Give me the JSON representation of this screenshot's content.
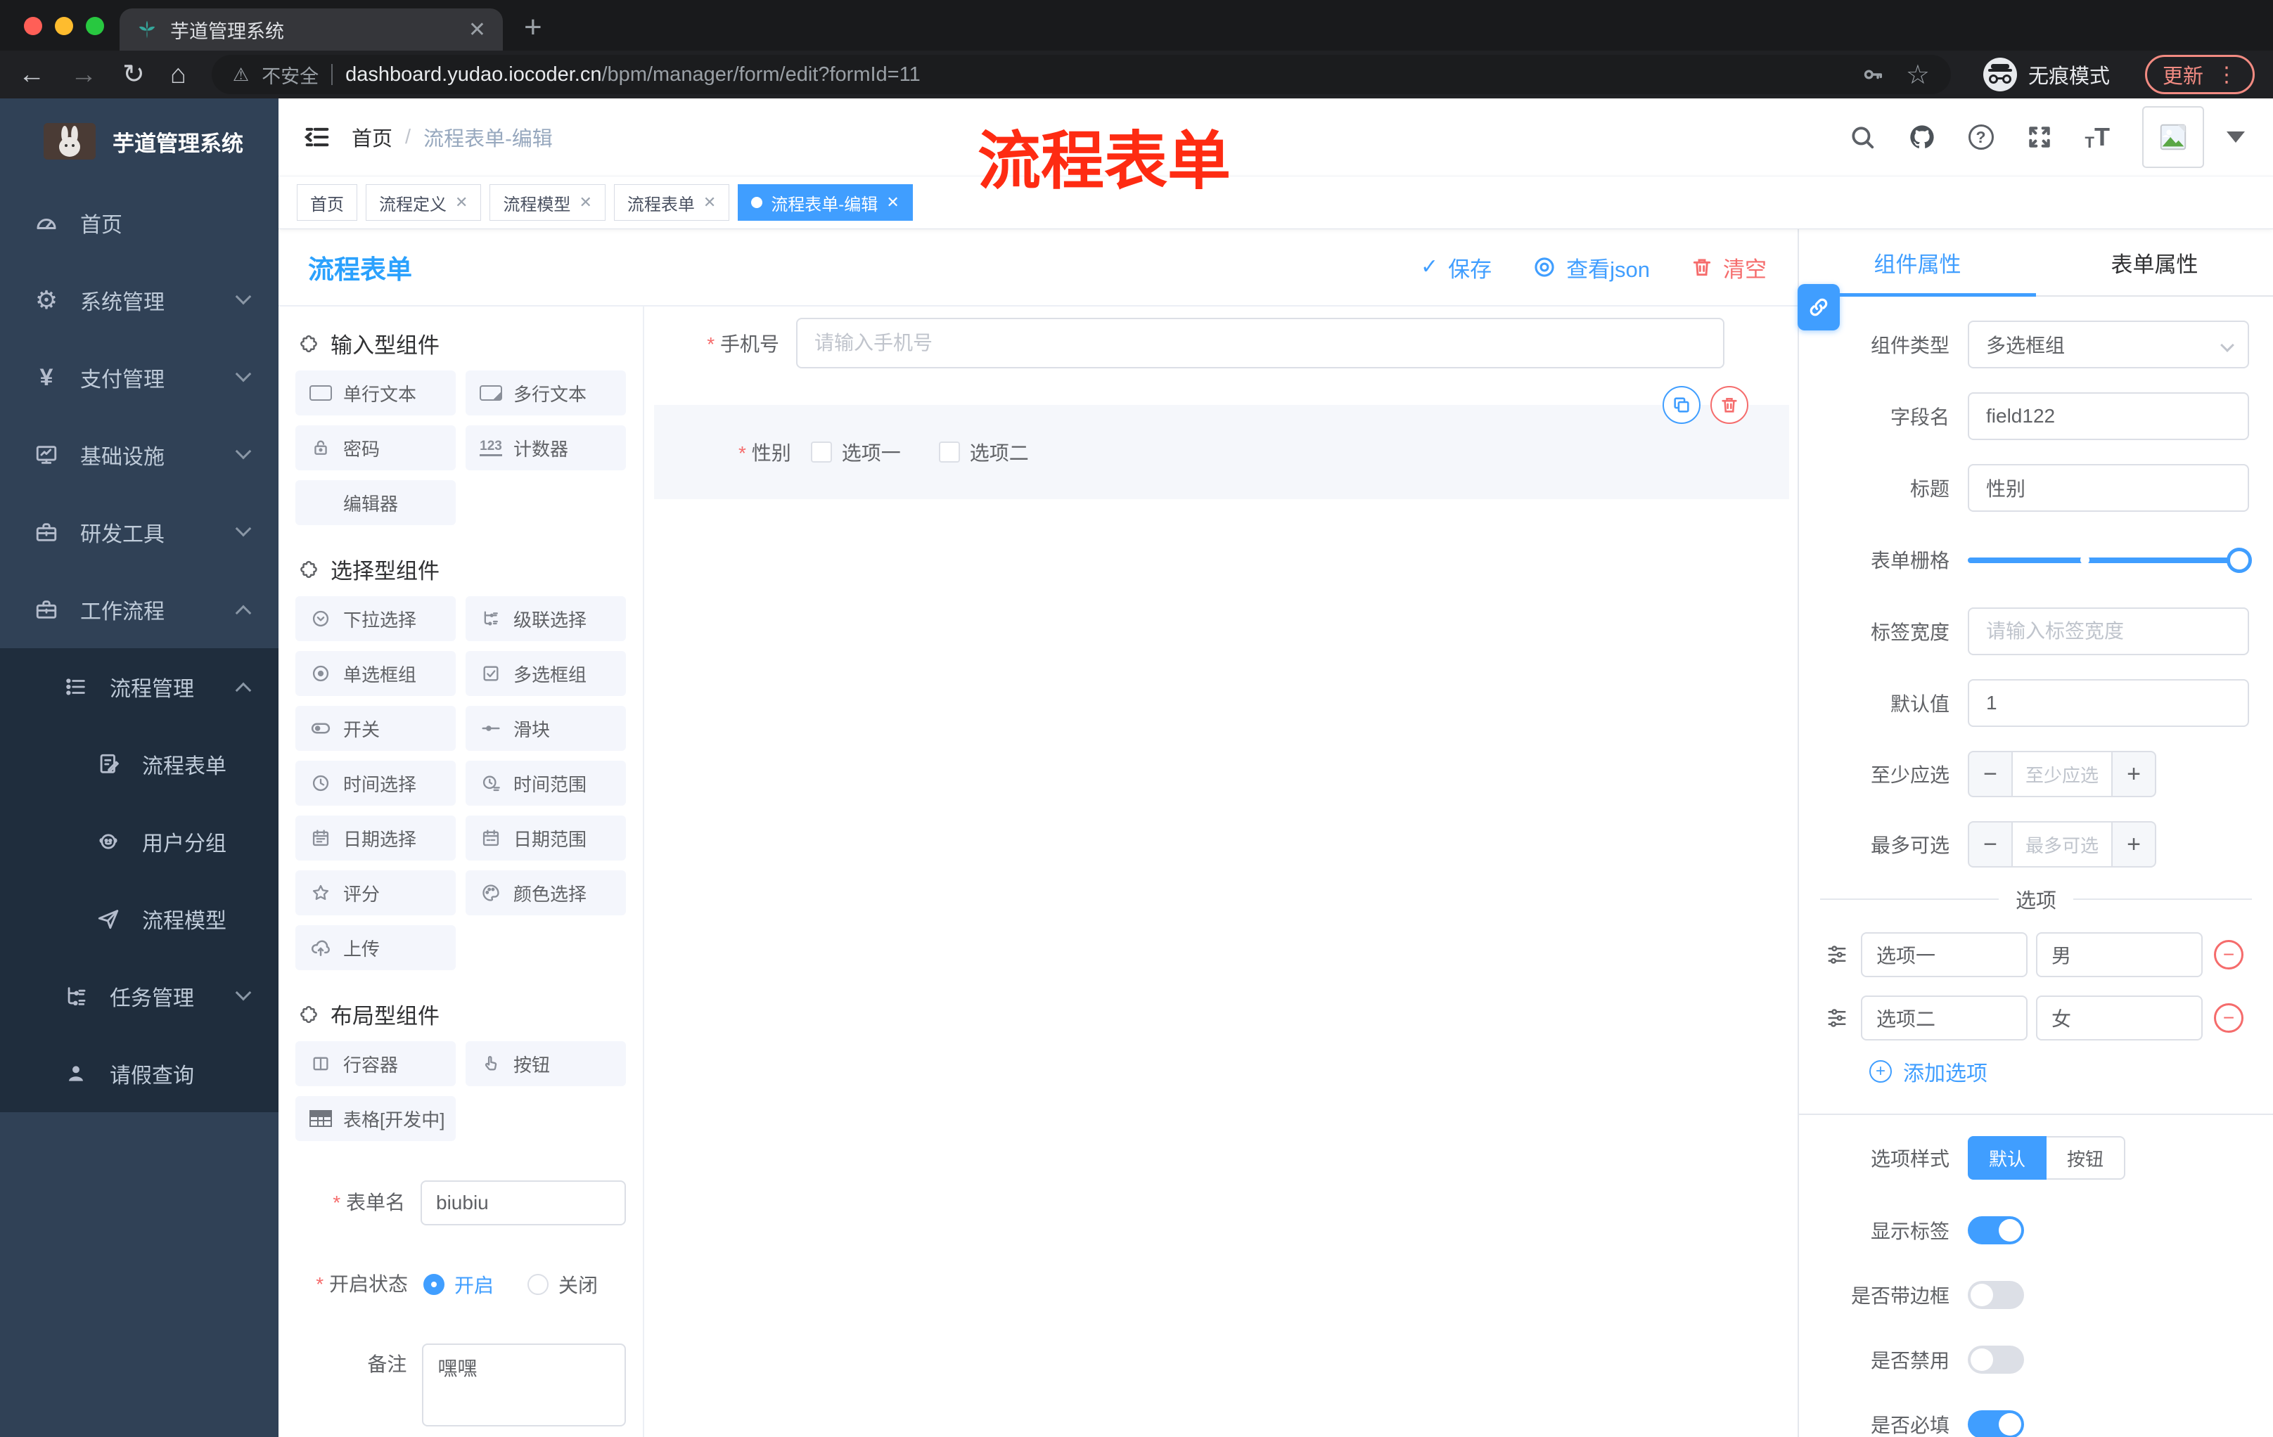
{
  "appearance": {
    "accent": "#409eff",
    "danger": "#f56c6c",
    "sidebar_bg": "#304156",
    "sidebar_submenu_bg": "#1f2d3d",
    "chrome_bg": "#202124",
    "active_tag_bg": "#409eff",
    "annotation_color": "#fe2b12"
  },
  "browser": {
    "tab_title": "芋道管理系统",
    "security_label": "不安全",
    "url_domain": "dashboard.yudao.iocoder.cn",
    "url_path": "/bpm/manager/form/edit?formId=11",
    "incognito_label": "无痕模式",
    "update_label": "更新"
  },
  "sidebar": {
    "brand": "芋道管理系统",
    "menu": [
      {
        "label": "首页",
        "icon": "dashboard"
      },
      {
        "label": "系统管理",
        "icon": "gear",
        "chevron": "down"
      },
      {
        "label": "支付管理",
        "icon": "yen",
        "chevron": "down"
      },
      {
        "label": "基础设施",
        "icon": "monitor",
        "chevron": "down"
      },
      {
        "label": "研发工具",
        "icon": "briefcase",
        "chevron": "down"
      },
      {
        "label": "工作流程",
        "icon": "briefcase",
        "chevron": "up",
        "children": [
          {
            "label": "流程管理",
            "icon": "list",
            "chevron": "up",
            "children": [
              {
                "label": "流程表单",
                "icon": "doc-edit"
              },
              {
                "label": "用户分组",
                "icon": "face"
              },
              {
                "label": "流程模型",
                "icon": "plane"
              }
            ]
          },
          {
            "label": "任务管理",
            "icon": "tree",
            "chevron": "down"
          },
          {
            "label": "请假查询",
            "icon": "person"
          }
        ]
      }
    ]
  },
  "header": {
    "breadcrumb": [
      "首页",
      "流程表单-编辑"
    ],
    "annotation": "流程表单"
  },
  "tags": [
    {
      "label": "首页",
      "closable": false,
      "active": false
    },
    {
      "label": "流程定义",
      "closable": true,
      "active": false
    },
    {
      "label": "流程模型",
      "closable": true,
      "active": false
    },
    {
      "label": "流程表单",
      "closable": true,
      "active": false
    },
    {
      "label": "流程表单-编辑",
      "closable": true,
      "active": true
    }
  ],
  "editor": {
    "title": "流程表单",
    "save": "保存",
    "view_json": "查看json",
    "clear": "清空"
  },
  "components": {
    "sections": [
      {
        "title": "输入型组件",
        "items": [
          {
            "label": "单行文本",
            "icon": "input"
          },
          {
            "label": "多行文本",
            "icon": "textarea"
          },
          {
            "label": "密码",
            "icon": "lock"
          },
          {
            "label": "计数器",
            "icon": "counter"
          },
          {
            "label": "编辑器",
            "icon": "blank"
          }
        ]
      },
      {
        "title": "选择型组件",
        "items": [
          {
            "label": "下拉选择",
            "icon": "select"
          },
          {
            "label": "级联选择",
            "icon": "cascade"
          },
          {
            "label": "单选框组",
            "icon": "radio"
          },
          {
            "label": "多选框组",
            "icon": "checkbox"
          },
          {
            "label": "开关",
            "icon": "switch"
          },
          {
            "label": "滑块",
            "icon": "slider"
          },
          {
            "label": "时间选择",
            "icon": "time"
          },
          {
            "label": "时间范围",
            "icon": "time-range"
          },
          {
            "label": "日期选择",
            "icon": "date"
          },
          {
            "label": "日期范围",
            "icon": "date-range"
          },
          {
            "label": "评分",
            "icon": "star"
          },
          {
            "label": "颜色选择",
            "icon": "palette"
          },
          {
            "label": "上传",
            "icon": "upload"
          }
        ]
      },
      {
        "title": "布局型组件",
        "items": [
          {
            "label": "行容器",
            "icon": "columns"
          },
          {
            "label": "按钮",
            "icon": "pointer"
          },
          {
            "label": "表格[开发中]",
            "icon": "table"
          }
        ]
      }
    ]
  },
  "meta_form": {
    "name_label": "表单名",
    "name_value": "biubiu",
    "status_label": "开启状态",
    "status_options": [
      "开启",
      "关闭"
    ],
    "status_selected": "开启",
    "remark_label": "备注",
    "remark_value": "嘿嘿"
  },
  "canvas": {
    "phone": {
      "label": "手机号",
      "placeholder": "请输入手机号",
      "required": true
    },
    "gender": {
      "label": "性别",
      "required": true,
      "options": [
        "选项一",
        "选项二"
      ]
    }
  },
  "props": {
    "tabs": [
      "组件属性",
      "表单属性"
    ],
    "active_tab": "组件属性",
    "component_type_label": "组件类型",
    "component_type_value": "多选框组",
    "field_name_label": "字段名",
    "field_name_value": "field122",
    "title_label": "标题",
    "title_value": "性别",
    "grid_label": "表单栅格",
    "label_width_label": "标签宽度",
    "label_width_placeholder": "请输入标签宽度",
    "default_label": "默认值",
    "default_value": "1",
    "min_label": "至少应选",
    "min_placeholder": "至少应选",
    "max_label": "最多可选",
    "max_placeholder": "最多可选",
    "options_title": "选项",
    "options": [
      {
        "label": "选项一",
        "value": "男"
      },
      {
        "label": "选项二",
        "value": "女"
      }
    ],
    "add_option_label": "添加选项",
    "option_style_label": "选项样式",
    "option_style_choices": [
      "默认",
      "按钮"
    ],
    "option_style_selected": "默认",
    "switches": [
      {
        "label": "显示标签",
        "on": true
      },
      {
        "label": "是否带边框",
        "on": false
      },
      {
        "label": "是否禁用",
        "on": false
      },
      {
        "label": "是否必填",
        "on": true
      }
    ]
  }
}
